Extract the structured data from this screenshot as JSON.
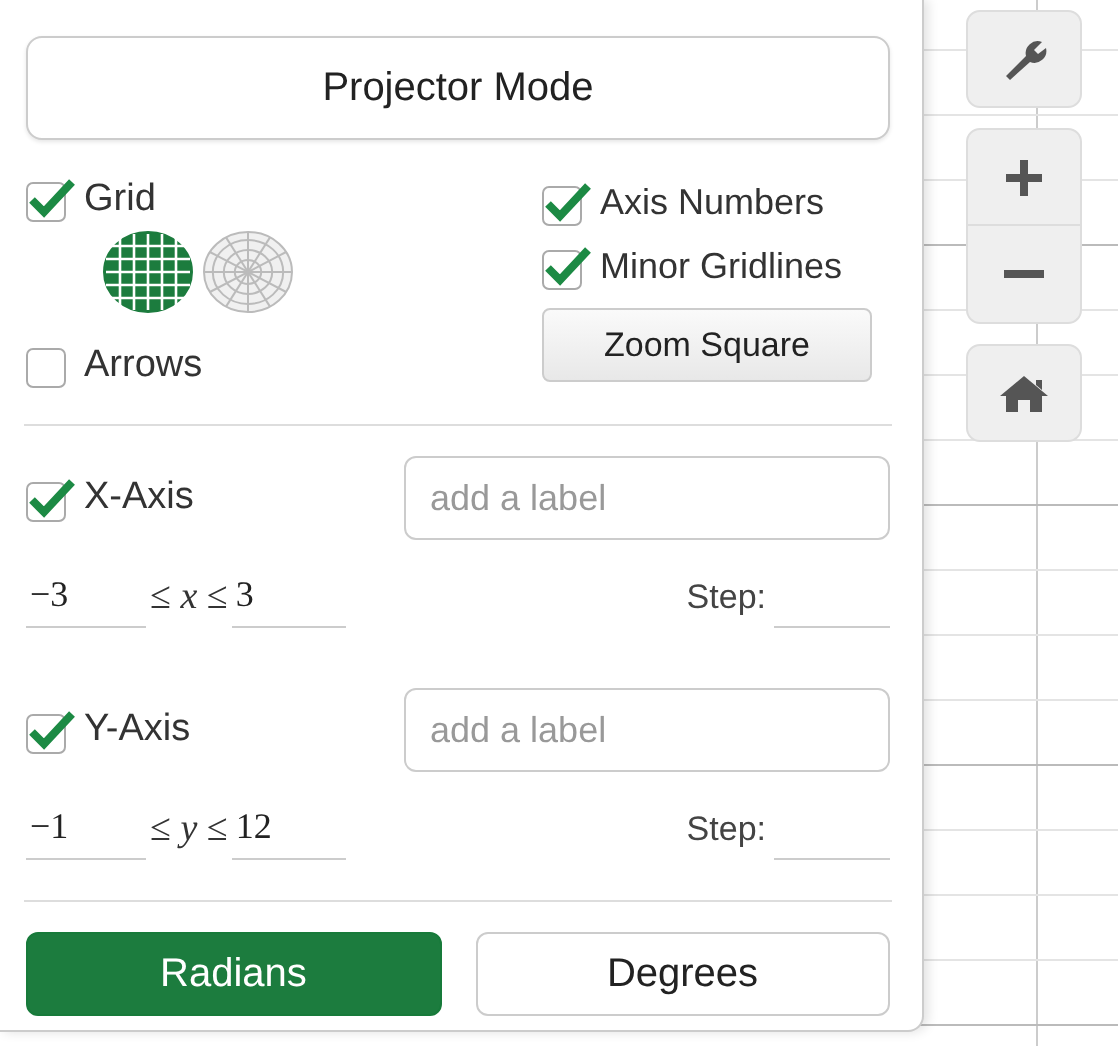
{
  "projector_mode": {
    "label": "Projector Mode"
  },
  "grid": {
    "label": "Grid",
    "checked": true
  },
  "grid_types": [
    {
      "kind": "cartesian",
      "selected": true
    },
    {
      "kind": "polar",
      "selected": false
    }
  ],
  "arrows": {
    "label": "Arrows",
    "checked": false
  },
  "axis_numbers": {
    "label": "Axis Numbers",
    "checked": true
  },
  "minor_gridlines": {
    "label": "Minor Gridlines",
    "checked": true
  },
  "zoom_square": {
    "label": "Zoom Square"
  },
  "axes": [
    {
      "label": "X-Axis",
      "checked": true,
      "placeholder": "add a label",
      "min": "−3",
      "relation": "≤ *x* ≤",
      "max": "3",
      "step_label": "Step:"
    },
    {
      "label": "Y-Axis",
      "checked": true,
      "placeholder": "add a label",
      "min": "−1",
      "relation": "≤ *y* ≤",
      "max": "12",
      "step_label": "Step:"
    }
  ],
  "angle_units": [
    {
      "label": "Radians",
      "selected": true
    },
    {
      "label": "Degrees",
      "selected": false
    }
  ]
}
